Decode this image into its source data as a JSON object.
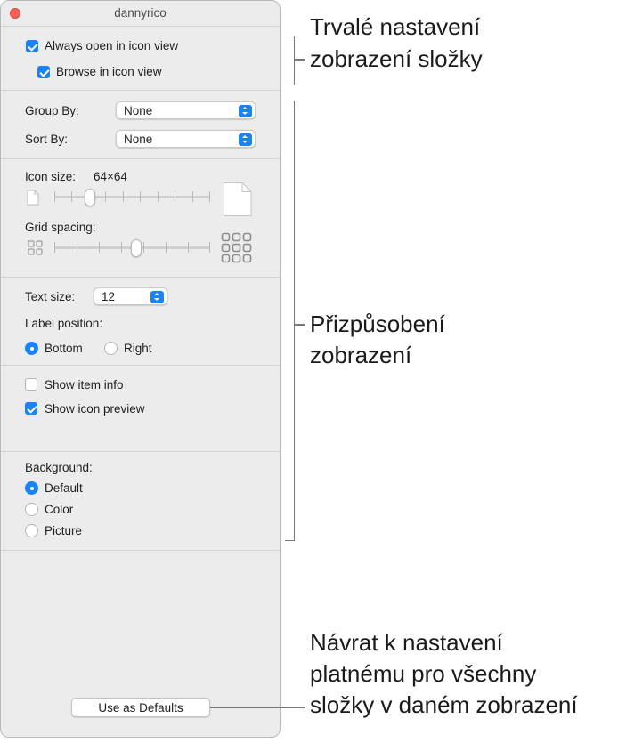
{
  "window": {
    "title": "dannyrico"
  },
  "general": {
    "always_open_label": "Always open in icon view",
    "always_open_checked": true,
    "browse_label": "Browse in icon view",
    "browse_checked": true
  },
  "arrange": {
    "group_by_label": "Group By:",
    "group_by_value": "None",
    "sort_by_label": "Sort By:",
    "sort_by_value": "None"
  },
  "icon_size": {
    "label": "Icon size:",
    "value": "64×64"
  },
  "grid_spacing": {
    "label": "Grid spacing:"
  },
  "text": {
    "size_label": "Text size:",
    "size_value": "12",
    "label_position_label": "Label position:",
    "positions": [
      "Bottom",
      "Right"
    ],
    "selected_position": "Bottom"
  },
  "options": {
    "show_item_info_label": "Show item info",
    "show_item_info_checked": false,
    "show_icon_preview_label": "Show icon preview",
    "show_icon_preview_checked": true
  },
  "background": {
    "label": "Background:",
    "choices": [
      "Default",
      "Color",
      "Picture"
    ],
    "selected": "Default"
  },
  "footer": {
    "defaults_button": "Use as Defaults"
  },
  "annotations": {
    "persistent": [
      "Trvalé nastavení",
      "zobrazení složky"
    ],
    "customize": [
      "Přizpůsobení",
      "zobrazení"
    ],
    "defaults": [
      "Návrat k nastavení",
      "platnému pro všechny",
      "složky v daném zobrazení"
    ]
  },
  "colors": {
    "accent": "#1a82fb",
    "close": "#fe5f57",
    "panel": "#ececec"
  }
}
